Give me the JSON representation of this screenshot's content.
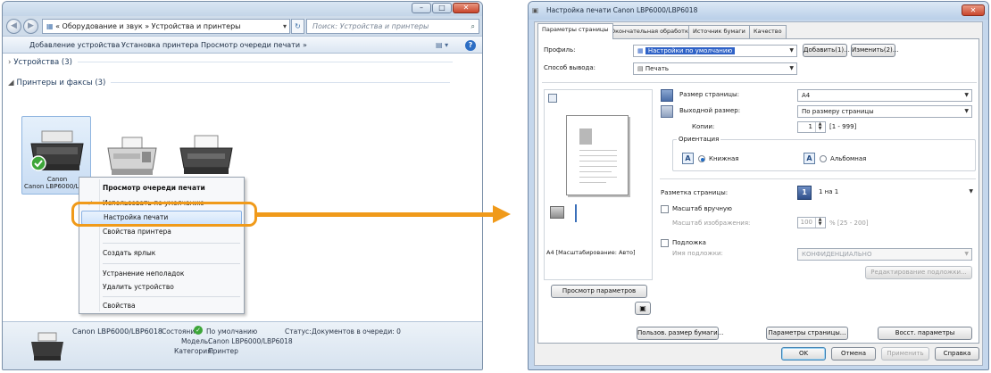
{
  "explorer": {
    "address_path": "« Оборудование и звук » Устройства и принтеры",
    "search_placeholder": "Поиск: Устройства и принтеры",
    "toolbar": {
      "add_device": "Добавление устройства",
      "add_printer": "Установка принтера",
      "view_queue": "Просмотр очереди печати",
      "more": "»"
    },
    "groups": {
      "devices": "Устройства (3)",
      "printers": "Принтеры и факсы (3)"
    },
    "selected_printer_label": "Canon LBP6000/LBP60",
    "context_menu": {
      "items": [
        "Просмотр очереди печати",
        "Использовать по умолчанию",
        "Настройка печати",
        "Свойства принтера",
        "Создать ярлык",
        "Устранение неполадок",
        "Удалить устройство",
        "Свойства"
      ]
    },
    "details": {
      "name": "Canon LBP6000/LBP6018",
      "state_label": "Состояние:",
      "state_value": "По умолчанию",
      "status_label": "Статус:",
      "status_value": "Документов в очереди: 0",
      "model_label": "Модель:",
      "model_value": "Canon LBP6000/LBP6018",
      "category_label": "Категория:",
      "category_value": "Принтер"
    }
  },
  "dialog": {
    "title": "Настройка печати Canon LBP6000/LBP6018",
    "close": "✕",
    "tabs": [
      "Параметры страницы",
      "Окончательная обработка",
      "Источник бумаги",
      "Качество"
    ],
    "profile_label": "Профиль:",
    "profile_value": "Настройки по умолчанию",
    "add_button": "Добавить(1)...",
    "edit_button": "Изменить(2)...",
    "output_label": "Способ вывода:",
    "output_value": "Печать",
    "preview_caption": "A4 [Масштабирование: Авто]",
    "page_size_label": "Размер страницы:",
    "page_size_value": "A4",
    "output_size_label": "Выходной размер:",
    "output_size_value": "По размеру страницы",
    "copies_label": "Копии:",
    "copies_value": "1",
    "copies_range": "[1 - 999]",
    "orientation_label": "Ориентация",
    "portrait": "Книжная",
    "landscape": "Альбомная",
    "page_layout_label": "Разметка страницы:",
    "page_layout_value": "1 на 1",
    "manual_scaling": "Масштаб вручную",
    "scaling_label": "Масштаб изображения:",
    "scaling_value": "100",
    "scaling_range": "% [25 - 200]",
    "watermark": "Подложка",
    "watermark_name_label": "Имя подложки:",
    "watermark_name_value": "КОНФИДЕНЦИАЛЬНО",
    "edit_watermark_button": "Редактирование подложки...",
    "view_settings_button": "Просмотр параметров",
    "custom_paper_button": "Пользов. размер бумаги...",
    "page_options_button": "Параметры страницы...",
    "restore_defaults_button": "Восст. параметры",
    "ok_button": "OK",
    "cancel_button": "Отмена",
    "apply_button": "Применить",
    "help_button": "Справка"
  },
  "colors": {
    "highlight": "#f09a1a",
    "window_frame": "#c5d7ec"
  }
}
